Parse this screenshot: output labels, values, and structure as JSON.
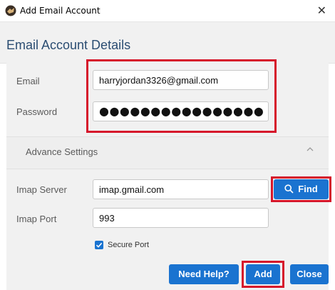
{
  "window": {
    "title": "Add Email Account",
    "close_label": "✕"
  },
  "header": {
    "title": "Email Account Details"
  },
  "form": {
    "email_label": "Email",
    "email_value": "harryjordan3326@gmail.com",
    "password_label": "Password",
    "password_value": "●●●●●●●●●●●●●●●●",
    "advanced_label": "Advance Settings",
    "imap_server_label": "Imap Server",
    "imap_server_value": "imap.gmail.com",
    "imap_port_label": "Imap Port",
    "imap_port_value": "993",
    "secure_port_label": "Secure Port",
    "secure_port_checked": true
  },
  "buttons": {
    "find": "Find",
    "need_help": "Need Help?",
    "add": "Add",
    "close": "Close"
  },
  "icons": [
    "app-icon",
    "close-icon",
    "chevron-up-icon",
    "search-icon",
    "checkbox-check-icon"
  ],
  "colors": {
    "accent": "#1a73d0",
    "highlight": "#d6162b",
    "title": "#2b4d72"
  }
}
